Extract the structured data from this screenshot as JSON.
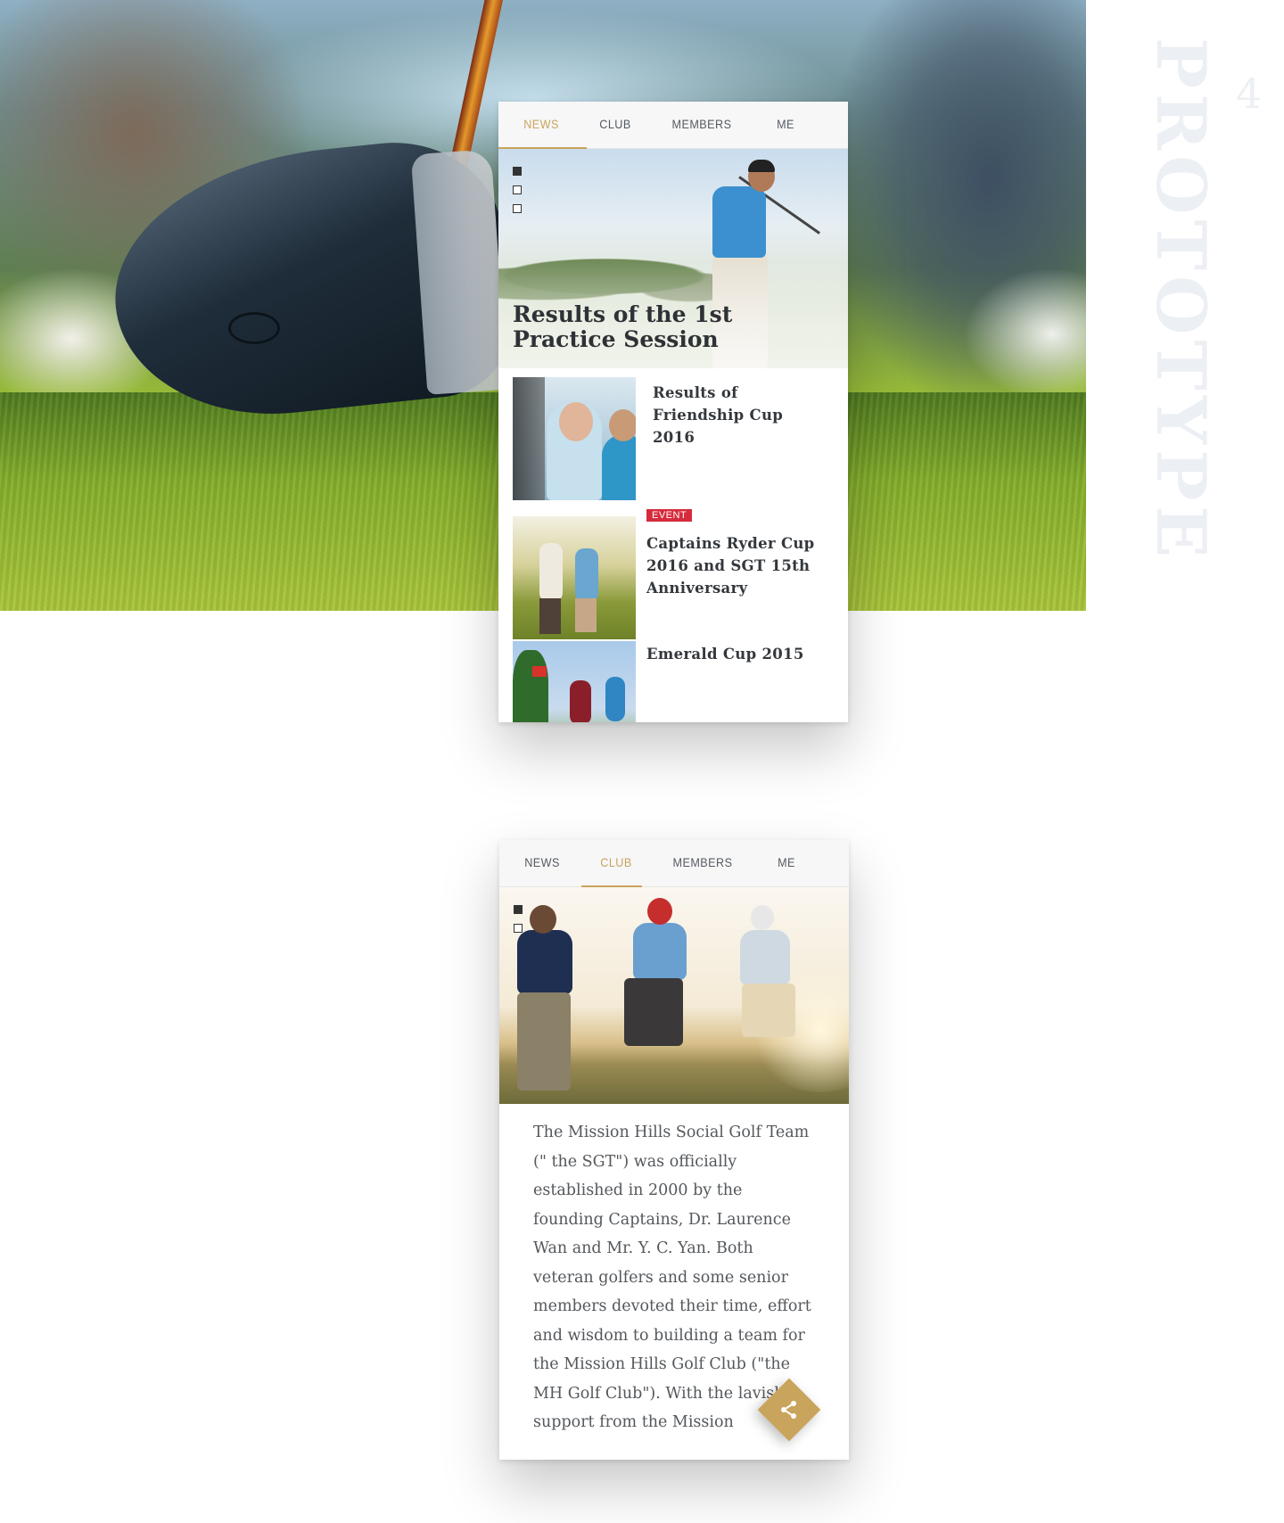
{
  "side_label": {
    "word": "PROTOTYPE",
    "number": "4"
  },
  "colors": {
    "accent": "#c9a45c",
    "badge": "#d52b3c",
    "text": "#34383c"
  },
  "screen_news": {
    "tabs": [
      {
        "label": "NEWS",
        "active": true
      },
      {
        "label": "CLUB",
        "active": false
      },
      {
        "label": "MEMBERS",
        "active": false
      },
      {
        "label": "ME",
        "active": false
      }
    ],
    "carousel_active_index": 0,
    "carousel_count": 3,
    "feature_title": "Results of the 1st Practice Session",
    "items": [
      {
        "title": "Results of Friendship Cup 2016",
        "badge": ""
      },
      {
        "title": "Captains Ryder Cup 2016 and SGT 15th Anniversary",
        "badge": "EVENT"
      },
      {
        "title": "Emerald Cup 2015",
        "badge": ""
      }
    ]
  },
  "screen_club": {
    "tabs": [
      {
        "label": "NEWS",
        "active": false
      },
      {
        "label": "CLUB",
        "active": true
      },
      {
        "label": "MEMBERS",
        "active": false
      },
      {
        "label": "ME",
        "active": false
      }
    ],
    "carousel_active_index": 0,
    "carousel_count": 2,
    "article_text": "The Mission Hills Social Golf Team (\" the SGT\") was officially established in 2000 by the founding Captains, Dr. Laurence Wan and Mr. Y. C. Yan. Both veteran golfers and some senior members devoted their time, effort and wisdom to building a team for the Mission Hills Golf Club (\"the MH Golf Club\"). With the lavish support from the Mission",
    "share_icon": "share-icon"
  }
}
